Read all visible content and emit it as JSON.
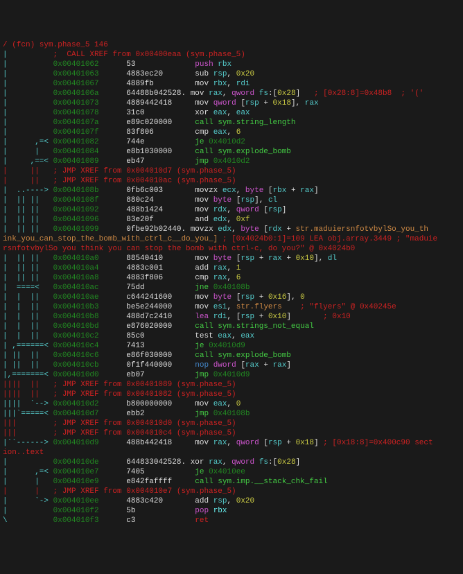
{
  "header": {
    "fcn": "/ (fcn) sym.phase_5 146",
    "xref0": ";  CALL XREF from 0x00400eaa (sym.phase_5)"
  },
  "lines": [
    {
      "flow": "|          ",
      "addr": "0x00401062",
      "bytes": "53            ",
      "inst": "push",
      "op": " rbx",
      "c1": "magenta",
      "c2": "cyan"
    },
    {
      "flow": "|          ",
      "addr": "0x00401063",
      "bytes": "4883ec20      ",
      "inst": "sub",
      "op": " rsp, 0x20",
      "c1": "white",
      "c2": "cyan"
    },
    {
      "flow": "|          ",
      "addr": "0x00401067",
      "bytes": "4889fb        ",
      "inst": "mov",
      "op": " rbx, rdi",
      "c1": "white",
      "c2": "cyan"
    },
    {
      "flow": "|          ",
      "addr": "0x0040106a",
      "bytes": "64488b042528.",
      "inst": "mov",
      "op": " rax, qword fs:[0x28]",
      "c1": "white",
      "c2": "cyan",
      "cmt": "   ; [0x28:8]=0x48b8  ; '('"
    },
    {
      "flow": "|          ",
      "addr": "0x00401073",
      "bytes": "4889442418    ",
      "inst": "mov",
      "op": " qword [rsp + 0x18], rax",
      "c1": "white",
      "c2": "cyan"
    },
    {
      "flow": "|          ",
      "addr": "0x00401078",
      "bytes": "31c0          ",
      "inst": "xor",
      "op": " eax, eax",
      "c1": "white",
      "c2": "cyan"
    },
    {
      "flow": "|          ",
      "addr": "0x0040107a",
      "bytes": "e89c020000    ",
      "inst": "call",
      "op": " sym.string_length",
      "c1": "green",
      "c2": "green",
      "bold": true
    },
    {
      "flow": "|          ",
      "addr": "0x0040107f",
      "bytes": "83f806        ",
      "inst": "cmp",
      "op": " eax, 6",
      "c1": "white",
      "c2": "cyan"
    },
    {
      "flow": "|      ,=< ",
      "addr": "0x00401082",
      "bytes": "744e          ",
      "inst": "je",
      "op": " 0x4010d2",
      "c1": "green",
      "c2": "dgreen"
    },
    {
      "flow": "|      |   ",
      "addr": "0x00401084",
      "bytes": "e8b1030000    ",
      "inst": "call",
      "op": " sym.explode_bomb",
      "c1": "green",
      "c2": "green",
      "bold": true
    },
    {
      "flow": "|     ,==< ",
      "addr": "0x00401089",
      "bytes": "eb47          ",
      "inst": "jmp",
      "op": " 0x4010d2",
      "c1": "green",
      "c2": "dgreen"
    }
  ],
  "xref1": "|     ||   ; JMP XREF from 0x004010d7 (sym.phase_5)",
  "xref2": "|     ||   ; JMP XREF from 0x004010ac (sym.phase_5)",
  "lines2": [
    {
      "flow": "|  ..----> ",
      "addr": "0x0040108b",
      "bytes": "0fb6c003      ",
      "inst": "movzx",
      "op": " ecx, byte [rbx + rax]",
      "c1": "white",
      "c2": "cyan"
    },
    {
      "flow": "|  || ||   ",
      "addr": "0x0040108f",
      "bytes": "880c24        ",
      "inst": "mov",
      "op": " byte [rsp], cl",
      "c1": "white",
      "c2": "cyan"
    },
    {
      "flow": "|  || ||   ",
      "addr": "0x00401092",
      "bytes": "488b1424      ",
      "inst": "mov",
      "op": " rdx, qword [rsp]",
      "c1": "white",
      "c2": "cyan"
    },
    {
      "flow": "|  || ||   ",
      "addr": "0x00401096",
      "bytes": "83e20f        ",
      "inst": "and",
      "op": " edx, 0xf",
      "c1": "white",
      "c2": "cyan"
    }
  ],
  "longline": {
    "flow": "|  || ||   ",
    "addr": "0x00401099",
    "bytes": "0fbe92b02440.",
    "inst": "movzx",
    "op": " edx, byte [rdx + str.maduiersnfotvbylSo_you_th",
    "c1": "white",
    "c2": "cyan",
    "wrap": "ink_you_can_stop_the_bomb_with_ctrl_c__do_you_]",
    "cmt1": "; [0x4024b0:1]=109 LEA obj.array.3449 ; \"maduie",
    "cmt2": "rsnfotvbylSo you think you can stop the bomb with ctrl-c, do you?\" @ 0x4024b0"
  },
  "lines3": [
    {
      "flow": "|  || ||   ",
      "addr": "0x004010a0",
      "bytes": "88540410      ",
      "inst": "mov",
      "op": " byte [rsp + rax + 0x10], dl",
      "c1": "white",
      "c2": "cyan"
    },
    {
      "flow": "|  || ||   ",
      "addr": "0x004010a4",
      "bytes": "4883c001      ",
      "inst": "add",
      "op": " rax, 1",
      "c1": "white",
      "c2": "cyan"
    },
    {
      "flow": "|  || ||   ",
      "addr": "0x004010a8",
      "bytes": "4883f806      ",
      "inst": "cmp",
      "op": " rax, 6",
      "c1": "white",
      "c2": "cyan"
    },
    {
      "flow": "|  ====<   ",
      "addr": "0x004010ac",
      "bytes": "75dd          ",
      "inst": "jne",
      "op": " 0x40108b",
      "c1": "green",
      "c2": "dgreen"
    },
    {
      "flow": "|  |  ||   ",
      "addr": "0x004010ae",
      "bytes": "c644241600    ",
      "inst": "mov",
      "op": " byte [rsp + 0x16], 0",
      "c1": "white",
      "c2": "cyan"
    },
    {
      "flow": "|  |  ||   ",
      "addr": "0x004010b3",
      "bytes": "be5e244000    ",
      "inst": "mov",
      "op": " esi, str.flyers",
      "c1": "white",
      "c2": "cyan",
      "cmt": "    ; \"flyers\" @ 0x40245e"
    },
    {
      "flow": "|  |  ||   ",
      "addr": "0x004010b8",
      "bytes": "488d7c2410    ",
      "inst": "lea",
      "op": " rdi, [rsp + 0x10]",
      "c1": "magenta",
      "c2": "cyan",
      "cmt": "       ; 0x10"
    },
    {
      "flow": "|  |  ||   ",
      "addr": "0x004010bd",
      "bytes": "e876020000    ",
      "inst": "call",
      "op": " sym.strings_not_equal",
      "c1": "green",
      "c2": "green",
      "bold": true
    },
    {
      "flow": "|  |  ||   ",
      "addr": "0x004010c2",
      "bytes": "85c0          ",
      "inst": "test",
      "op": " eax, eax",
      "c1": "white",
      "c2": "cyan"
    },
    {
      "flow": "| ,======< ",
      "addr": "0x004010c4",
      "bytes": "7413          ",
      "inst": "je",
      "op": " 0x4010d9",
      "c1": "green",
      "c2": "dgreen"
    },
    {
      "flow": "| ||  ||   ",
      "addr": "0x004010c6",
      "bytes": "e86f030000    ",
      "inst": "call",
      "op": " sym.explode_bomb",
      "c1": "green",
      "c2": "green",
      "bold": true
    },
    {
      "flow": "| ||  ||   ",
      "addr": "0x004010cb",
      "bytes": "0f1f440000    ",
      "inst": "nop",
      "op": " dword [rax + rax]",
      "c1": "blue",
      "c2": "cyan"
    },
    {
      "flow": "|,=======< ",
      "addr": "0x004010d0",
      "bytes": "eb07          ",
      "inst": "jmp",
      "op": " 0x4010d9",
      "c1": "green",
      "c2": "dgreen"
    }
  ],
  "xref3": "||||  ||   ; JMP XREF from 0x00401089 (sym.phase_5)",
  "xref4": "||||  ||   ; JMP XREF from 0x00401082 (sym.phase_5)",
  "lines4": [
    {
      "flow": "||||  `--> ",
      "addr": "0x004010d2",
      "bytes": "b800000000    ",
      "inst": "mov",
      "op": " eax, 0",
      "c1": "white",
      "c2": "cyan"
    },
    {
      "flow": "|||`=====< ",
      "addr": "0x004010d7",
      "bytes": "ebb2          ",
      "inst": "jmp",
      "op": " 0x40108b",
      "c1": "green",
      "c2": "dgreen"
    }
  ],
  "xref5": "|||        ; JMP XREF from 0x004010d0 (sym.phase_5)",
  "xref6": "|||        ; JMP XREF from 0x004010c4 (sym.phase_5)",
  "lines5": [
    {
      "flow": "|``------> ",
      "addr": "0x004010d9",
      "bytes": "488b442418    ",
      "inst": "mov",
      "op": " rax, qword [rsp + 0x18]",
      "c1": "white",
      "c2": "cyan",
      "cmt": " ; [0x18:8]=0x400c90 sect"
    }
  ],
  "section": "ion..text",
  "lines6": [
    {
      "flow": "|          ",
      "addr": "0x004010de",
      "bytes": "644833042528.",
      "inst": "xor",
      "op": " rax, qword fs:[0x28]",
      "c1": "white",
      "c2": "cyan"
    },
    {
      "flow": "|      ,=< ",
      "addr": "0x004010e7",
      "bytes": "7405          ",
      "inst": "je",
      "op": " 0x4010ee",
      "c1": "green",
      "c2": "dgreen"
    },
    {
      "flow": "|      |   ",
      "addr": "0x004010e9",
      "bytes": "e842faffff    ",
      "inst": "call",
      "op": " sym.imp.__stack_chk_fail",
      "c1": "green",
      "c2": "green",
      "bold": true
    }
  ],
  "xref7": "|      |   ; JMP XREF from 0x004010e7 (sym.phase_5)",
  "lines7": [
    {
      "flow": "|      `-> ",
      "addr": "0x004010ee",
      "bytes": "4883c420      ",
      "inst": "add",
      "op": " rsp, 0x20",
      "c1": "white",
      "c2": "cyan"
    },
    {
      "flow": "|          ",
      "addr": "0x004010f2",
      "bytes": "5b            ",
      "inst": "pop",
      "op": " rbx",
      "c1": "magenta",
      "c2": "bcyan",
      "bold": true
    },
    {
      "flow": "\\          ",
      "addr": "0x004010f3",
      "bytes": "c3            ",
      "inst": "ret",
      "op": "",
      "c1": "red",
      "c2": ""
    }
  ]
}
